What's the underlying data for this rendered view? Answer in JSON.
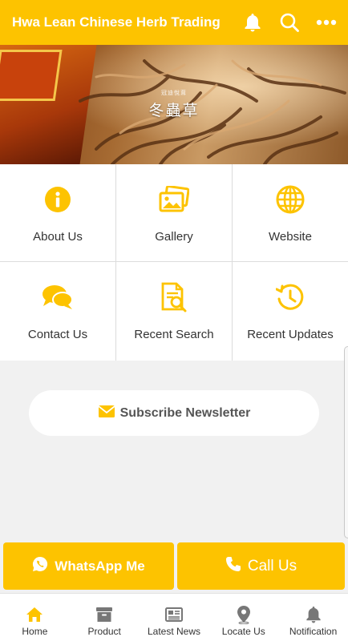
{
  "app": {
    "title": "Hwa Lean Chinese Herb Trading",
    "accent_color": "#fdc300",
    "actions": [
      {
        "icon": "bell-icon"
      },
      {
        "icon": "search-icon"
      },
      {
        "icon": "more-horizontal-icon"
      }
    ]
  },
  "hero": {
    "caption_small": "冠迪悅茸",
    "caption_big": "冬蟲草"
  },
  "menu": [
    {
      "label": "About Us",
      "icon": "info-icon"
    },
    {
      "label": "Gallery",
      "icon": "gallery-icon"
    },
    {
      "label": "Website",
      "icon": "globe-icon"
    },
    {
      "label": "Contact Us",
      "icon": "chat-bubbles-icon"
    },
    {
      "label": "Recent Search",
      "icon": "document-search-icon"
    },
    {
      "label": "Recent Updates",
      "icon": "history-clock-icon"
    }
  ],
  "subscribe": {
    "label": "Subscribe Newsletter",
    "icon": "envelope-icon"
  },
  "cta": {
    "whatsapp_label": "WhatsApp Me",
    "call_label": "Call Us"
  },
  "tabbar": [
    {
      "label": "Home",
      "icon": "home-icon",
      "active": true
    },
    {
      "label": "Product",
      "icon": "archive-box-icon"
    },
    {
      "label": "Latest News",
      "icon": "newspaper-icon"
    },
    {
      "label": "Locate Us",
      "icon": "map-pin-icon"
    },
    {
      "label": "Notification",
      "icon": "bell-icon"
    }
  ]
}
